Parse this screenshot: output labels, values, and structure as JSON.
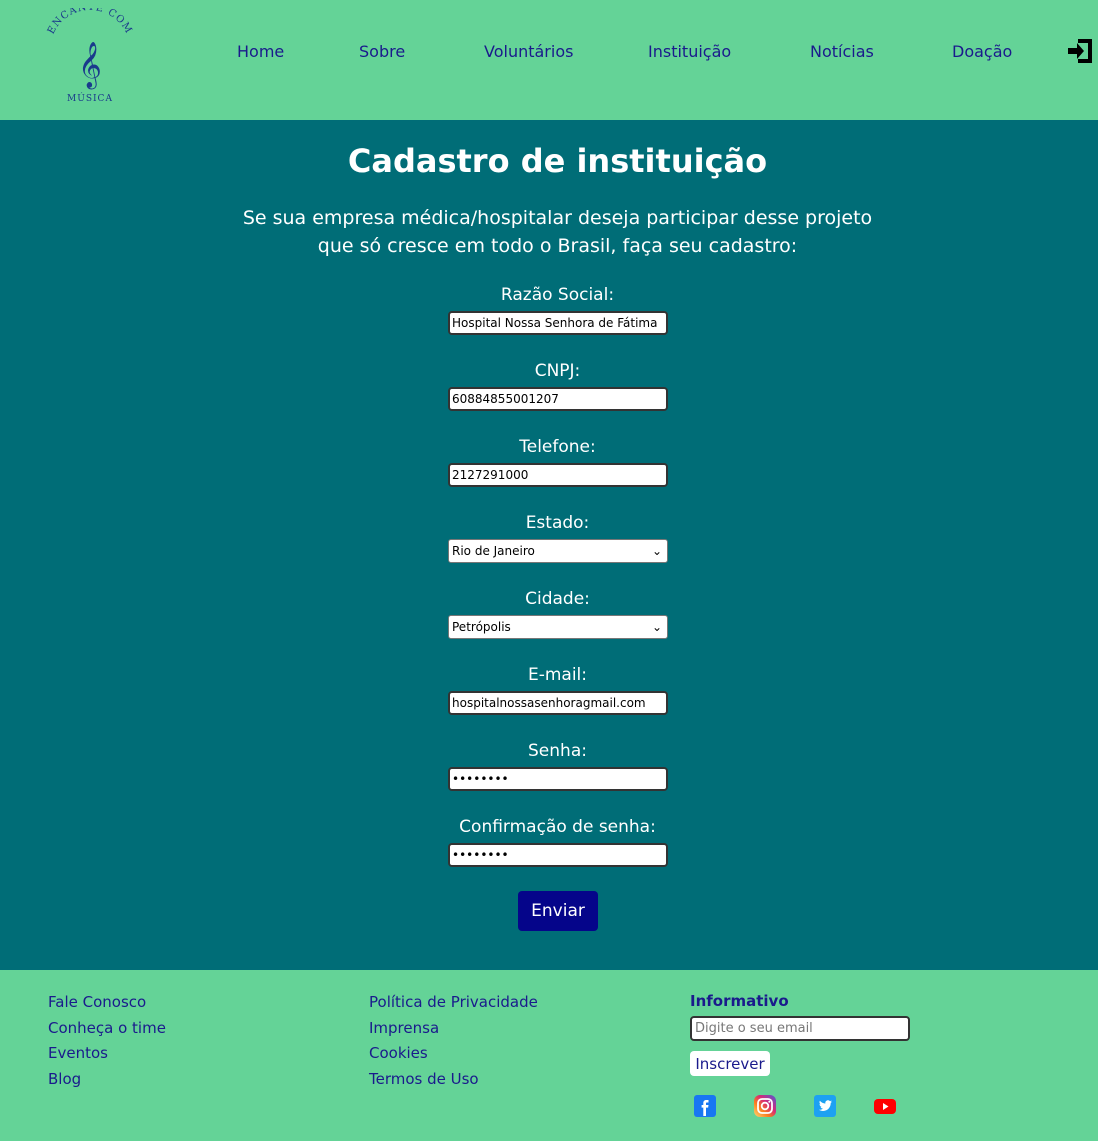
{
  "header": {
    "logo": {
      "top_text": "ENCANTE COM",
      "bottom_text": "MÚSICA"
    },
    "nav": [
      "Home",
      "Sobre",
      "Voluntários",
      "Instituição",
      "Notícias",
      "Doação"
    ],
    "logout_icon": "logout-icon"
  },
  "main": {
    "title": "Cadastro de instituição",
    "intro_line1": "Se sua empresa médica/hospitalar deseja participar desse projeto",
    "intro_line2": "que só cresce em todo o Brasil, faça seu cadastro:",
    "fields": [
      {
        "label": "Razão Social:",
        "value": "Hospital Nossa Senhora de Fátima"
      },
      {
        "label": "CNPJ:",
        "value": "60884855001207"
      },
      {
        "label": "Telefone:",
        "value": "2127291000"
      },
      {
        "label": "Estado:",
        "value": "Rio de Janeiro"
      },
      {
        "label": "Cidade:",
        "value": "Petrópolis"
      },
      {
        "label": "E-mail:",
        "value": "hospitalnossasenhoragmail.com"
      },
      {
        "label": "Senha:",
        "value": "••••••••"
      },
      {
        "label": "Confirmação de senha:",
        "value": "••••••••"
      }
    ],
    "submit_label": "Enviar"
  },
  "footer": {
    "col1": [
      "Fale Conosco",
      "Conheça o time",
      "Eventos",
      "Blog"
    ],
    "col2": [
      "Política de Privacidade",
      "Imprensa",
      "Cookies",
      "Termos de Uso"
    ],
    "newsletter": {
      "title": "Informativo",
      "placeholder": "Digite o seu email",
      "button": "Inscrever"
    },
    "social": [
      "facebook-icon",
      "instagram-icon",
      "twitter-icon",
      "youtube-icon"
    ]
  },
  "colors": {
    "header_bg": "#64d397",
    "main_bg": "#006d77",
    "link": "#1a1a8c",
    "button": "#05058a"
  }
}
